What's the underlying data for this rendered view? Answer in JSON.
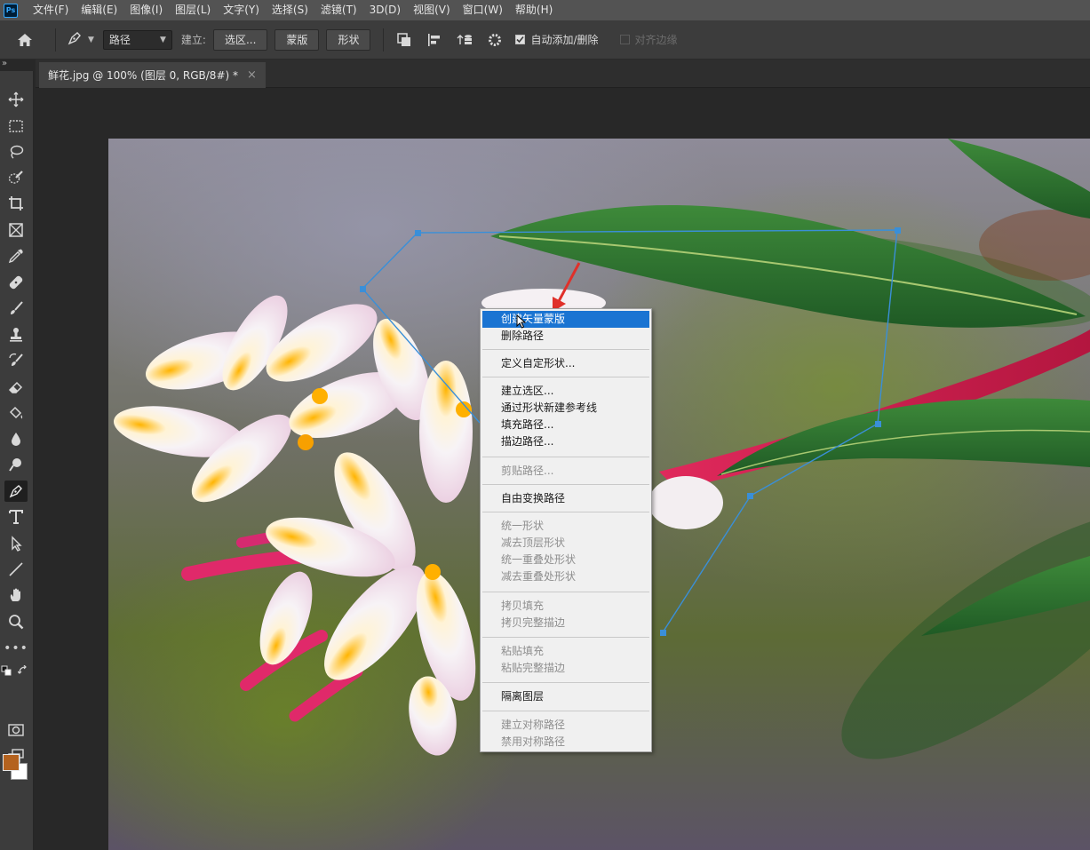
{
  "app": {
    "logo_text": "Ps",
    "menu": [
      "文件(F)",
      "编辑(E)",
      "图像(I)",
      "图层(L)",
      "文字(Y)",
      "选择(S)",
      "滤镜(T)",
      "3D(D)",
      "视图(V)",
      "窗口(W)",
      "帮助(H)"
    ]
  },
  "options": {
    "mode_select": "路径",
    "make_label": "建立:",
    "selection_button": "选区...",
    "mask_button": "蒙版",
    "shape_button": "形状",
    "auto_add_delete_label": "自动添加/删除",
    "auto_add_delete_checked": true,
    "align_edges_label": "对齐边缘",
    "align_edges_checked": false
  },
  "document": {
    "tab_title": "鲜花.jpg @ 100% (图层 0, RGB/8#) *",
    "close_glyph": "×"
  },
  "colors": {
    "foreground": "#b4621e",
    "background": "#ffffff",
    "highlight": "#1a74d2",
    "path_line": "#3a8fd8",
    "annotation_arrow": "#e0302a"
  },
  "context_menu": {
    "items": [
      {
        "label": "创建矢量蒙版",
        "state": "highlighted"
      },
      {
        "label": "删除路径",
        "state": "enabled"
      },
      {
        "label": "定义自定形状...",
        "state": "enabled"
      },
      {
        "label": "建立选区...",
        "state": "enabled"
      },
      {
        "label": "通过形状新建参考线",
        "state": "enabled"
      },
      {
        "label": "填充路径...",
        "state": "enabled"
      },
      {
        "label": "描边路径...",
        "state": "enabled"
      },
      {
        "label": "剪贴路径...",
        "state": "disabled"
      },
      {
        "label": "自由变换路径",
        "state": "enabled"
      },
      {
        "label": "统一形状",
        "state": "disabled"
      },
      {
        "label": "减去顶层形状",
        "state": "disabled"
      },
      {
        "label": "统一重叠处形状",
        "state": "disabled"
      },
      {
        "label": "减去重叠处形状",
        "state": "disabled"
      },
      {
        "label": "拷贝填充",
        "state": "disabled"
      },
      {
        "label": "拷贝完整描边",
        "state": "disabled"
      },
      {
        "label": "粘贴填充",
        "state": "disabled"
      },
      {
        "label": "粘贴完整描边",
        "state": "disabled"
      },
      {
        "label": "隔离图层",
        "state": "enabled"
      },
      {
        "label": "建立对称路径",
        "state": "disabled"
      },
      {
        "label": "禁用对称路径",
        "state": "disabled"
      }
    ]
  }
}
